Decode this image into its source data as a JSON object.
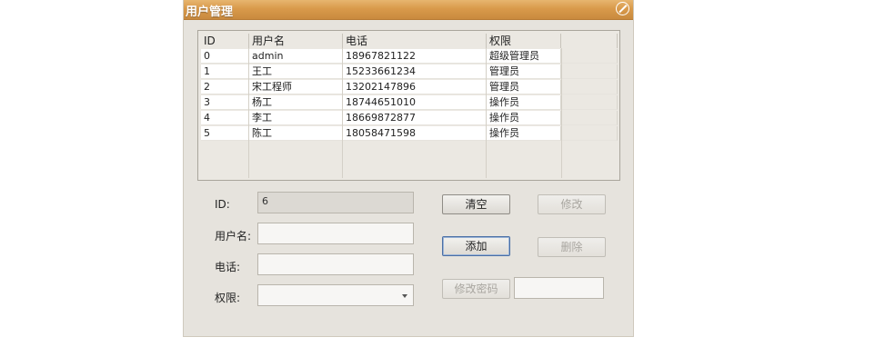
{
  "window": {
    "title": "用户管理"
  },
  "table": {
    "headers": [
      "ID",
      "用户名",
      "电话",
      "权限"
    ],
    "rows": [
      [
        "0",
        "admin",
        "18967821122",
        "超级管理员"
      ],
      [
        "1",
        "王工",
        "15233661234",
        "管理员"
      ],
      [
        "2",
        "宋工程师",
        "13202147896",
        "管理员"
      ],
      [
        "3",
        "杨工",
        "18744651010",
        "操作员"
      ],
      [
        "4",
        "李工",
        "18669872877",
        "操作员"
      ],
      [
        "5",
        "陈工",
        "18058471598",
        "操作员"
      ]
    ]
  },
  "form": {
    "id_label": "ID:",
    "id_value": "6",
    "username_label": "用户名:",
    "username_value": "",
    "phone_label": "电话:",
    "phone_value": "",
    "role_label": "权限:",
    "role_value": ""
  },
  "buttons": {
    "clear": "清空",
    "modify": "修改",
    "add": "添加",
    "delete": "删除",
    "change_password": "修改密码"
  },
  "password_field": {
    "value": ""
  },
  "colors": {
    "titlebar": "#d99a4b",
    "window_bg": "#e6e3dd"
  }
}
